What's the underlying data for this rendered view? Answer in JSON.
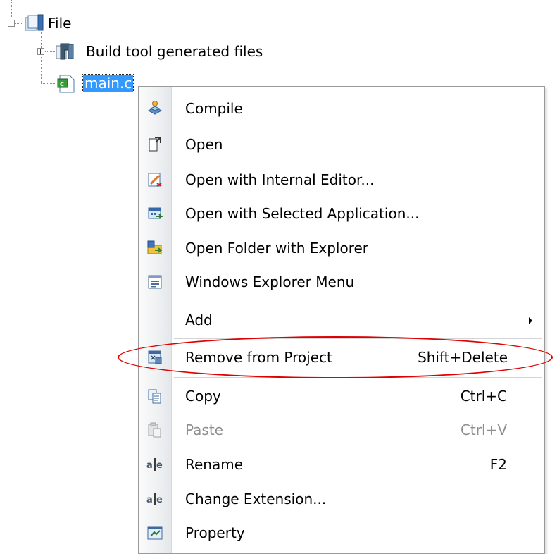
{
  "tree": {
    "root": {
      "label": "File",
      "icon": "project-folder-icon"
    },
    "children": [
      {
        "label": "Build tool generated files",
        "icon": "generated-files-folder-icon"
      },
      {
        "label": "main.c",
        "icon": "c-source-file-icon",
        "selected": true
      }
    ]
  },
  "context_menu": {
    "items": [
      {
        "label": "Compile",
        "icon": "compile-icon",
        "shortcut": ""
      },
      {
        "label": "Open",
        "icon": "open-icon",
        "shortcut": ""
      },
      {
        "label": "Open with Internal Editor...",
        "icon": "internal-editor-icon",
        "shortcut": ""
      },
      {
        "label": "Open with Selected Application...",
        "icon": "selected-application-icon",
        "shortcut": ""
      },
      {
        "label": "Open Folder with Explorer",
        "icon": "explorer-folder-icon",
        "shortcut": ""
      },
      {
        "label": "Windows Explorer Menu",
        "icon": "explorer-menu-icon",
        "shortcut": ""
      },
      {
        "label": "Add",
        "icon": "",
        "shortcut": "",
        "submenu": true
      },
      {
        "label": "Remove from Project",
        "icon": "remove-from-project-icon",
        "shortcut": "Shift+Delete",
        "annotated": true
      },
      {
        "label": "Copy",
        "icon": "copy-icon",
        "shortcut": "Ctrl+C"
      },
      {
        "label": "Paste",
        "icon": "paste-icon",
        "shortcut": "Ctrl+V",
        "disabled": true
      },
      {
        "label": "Rename",
        "icon": "rename-icon",
        "shortcut": "F2"
      },
      {
        "label": "Change Extension...",
        "icon": "change-extension-icon",
        "shortcut": ""
      },
      {
        "label": "Property",
        "icon": "property-icon",
        "shortcut": ""
      }
    ]
  },
  "colors": {
    "selection": "#3399ff",
    "annotation_ring": "#e00000",
    "disabled_text": "#8e8e8e"
  }
}
